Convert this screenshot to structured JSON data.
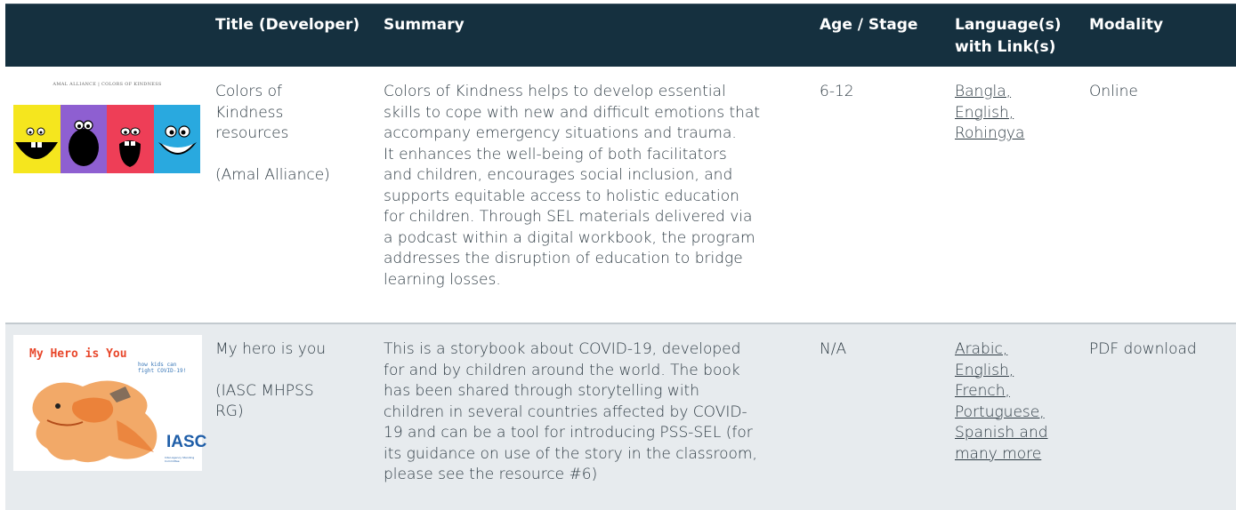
{
  "header": {
    "col_title": "Title (Developer)",
    "col_summary": "Summary",
    "col_age": "Age / Stage",
    "col_lang_line1": "Language(s)",
    "col_lang_line2": "with Link(s)",
    "col_modality": "Modality"
  },
  "rows": [
    {
      "image": {
        "caption": "AMAL ALLIANCE | COLORS OF KINDNESS",
        "panel_colors": [
          "#f5e61e",
          "#8e5fd1",
          "#ee3e57",
          "#29a9df"
        ]
      },
      "title_lines": [
        "Colors of",
        "Kindness",
        "resources"
      ],
      "developer": "(Amal Alliance)",
      "summary_lines": [
        "Colors of Kindness helps to develop essential",
        "skills to cope with new and difficult emotions that",
        "accompany emergency situations and trauma.",
        "It enhances the well-being of both facilitators",
        "and children, encourages social inclusion, and",
        "supports equitable access to holistic education",
        "for children. Through SEL materials delivered via",
        "a podcast within a digital workbook, the program",
        "addresses the disruption of education to bridge",
        "learning losses."
      ],
      "age": "6-12",
      "languages": [
        "Bangla,",
        "English,",
        "Rohingya"
      ],
      "modality": "Online"
    },
    {
      "image": {
        "title": "My Hero is You",
        "subtitle": "how kids can fight COVID-19!",
        "logo": "IASC",
        "logo_sub": "Inter-Agency Standing Committee"
      },
      "title": "My hero is you",
      "developer_lines": [
        "(IASC MHPSS",
        "RG)"
      ],
      "summary_lines": [
        "This is a storybook about COVID-19, developed",
        "for and by children around the world. The book",
        "has been shared through storytelling with",
        "children in several countries affected by COVID-",
        "19 and can be a tool for introducing PSS-SEL (for",
        "its guidance on use of the story in the classroom,",
        "please see the resource #6)"
      ],
      "age": "N/A",
      "languages": [
        "Arabic,",
        "English,",
        "French,",
        "Portuguese,",
        "Spanish and",
        "many more"
      ],
      "modality": "PDF download"
    }
  ],
  "colors": {
    "header_bg": "#15303f",
    "row_alt_bg": "#e7ebee",
    "text": "#2e3b44"
  }
}
